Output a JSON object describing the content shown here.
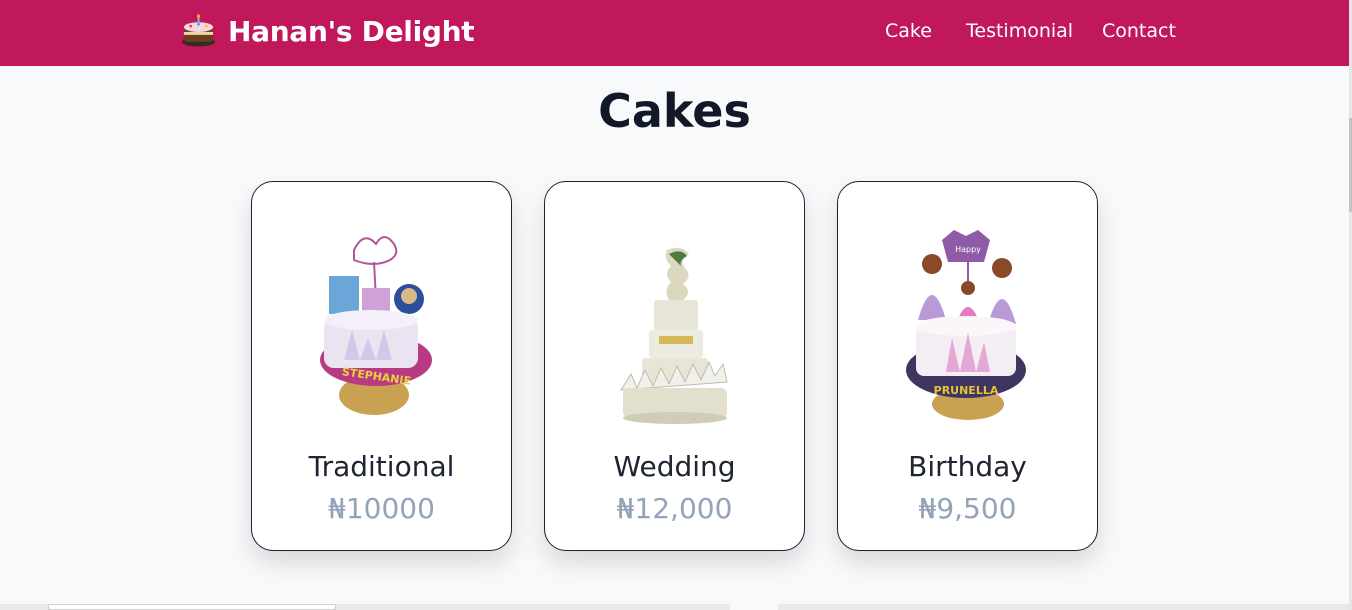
{
  "navbar": {
    "brand_name": "Hanan's Delight",
    "brand_icon": "cake-icon",
    "background": "#c0185a",
    "links": [
      {
        "label": "Cake"
      },
      {
        "label": "Testimonial"
      },
      {
        "label": "Contact"
      }
    ]
  },
  "section": {
    "title": "Cakes"
  },
  "cards": [
    {
      "name": "Traditional",
      "price": "₦10000",
      "image": "birthday-cake-frozen-image"
    },
    {
      "name": "Wedding",
      "price": "₦12,000",
      "image": "wedding-cake-image"
    },
    {
      "name": "Birthday",
      "price": "₦9,500",
      "image": "birthday-cake-princess-image"
    }
  ],
  "colors": {
    "title": "#111827",
    "price": "#94a3b8",
    "card_border": "#1e2230"
  }
}
